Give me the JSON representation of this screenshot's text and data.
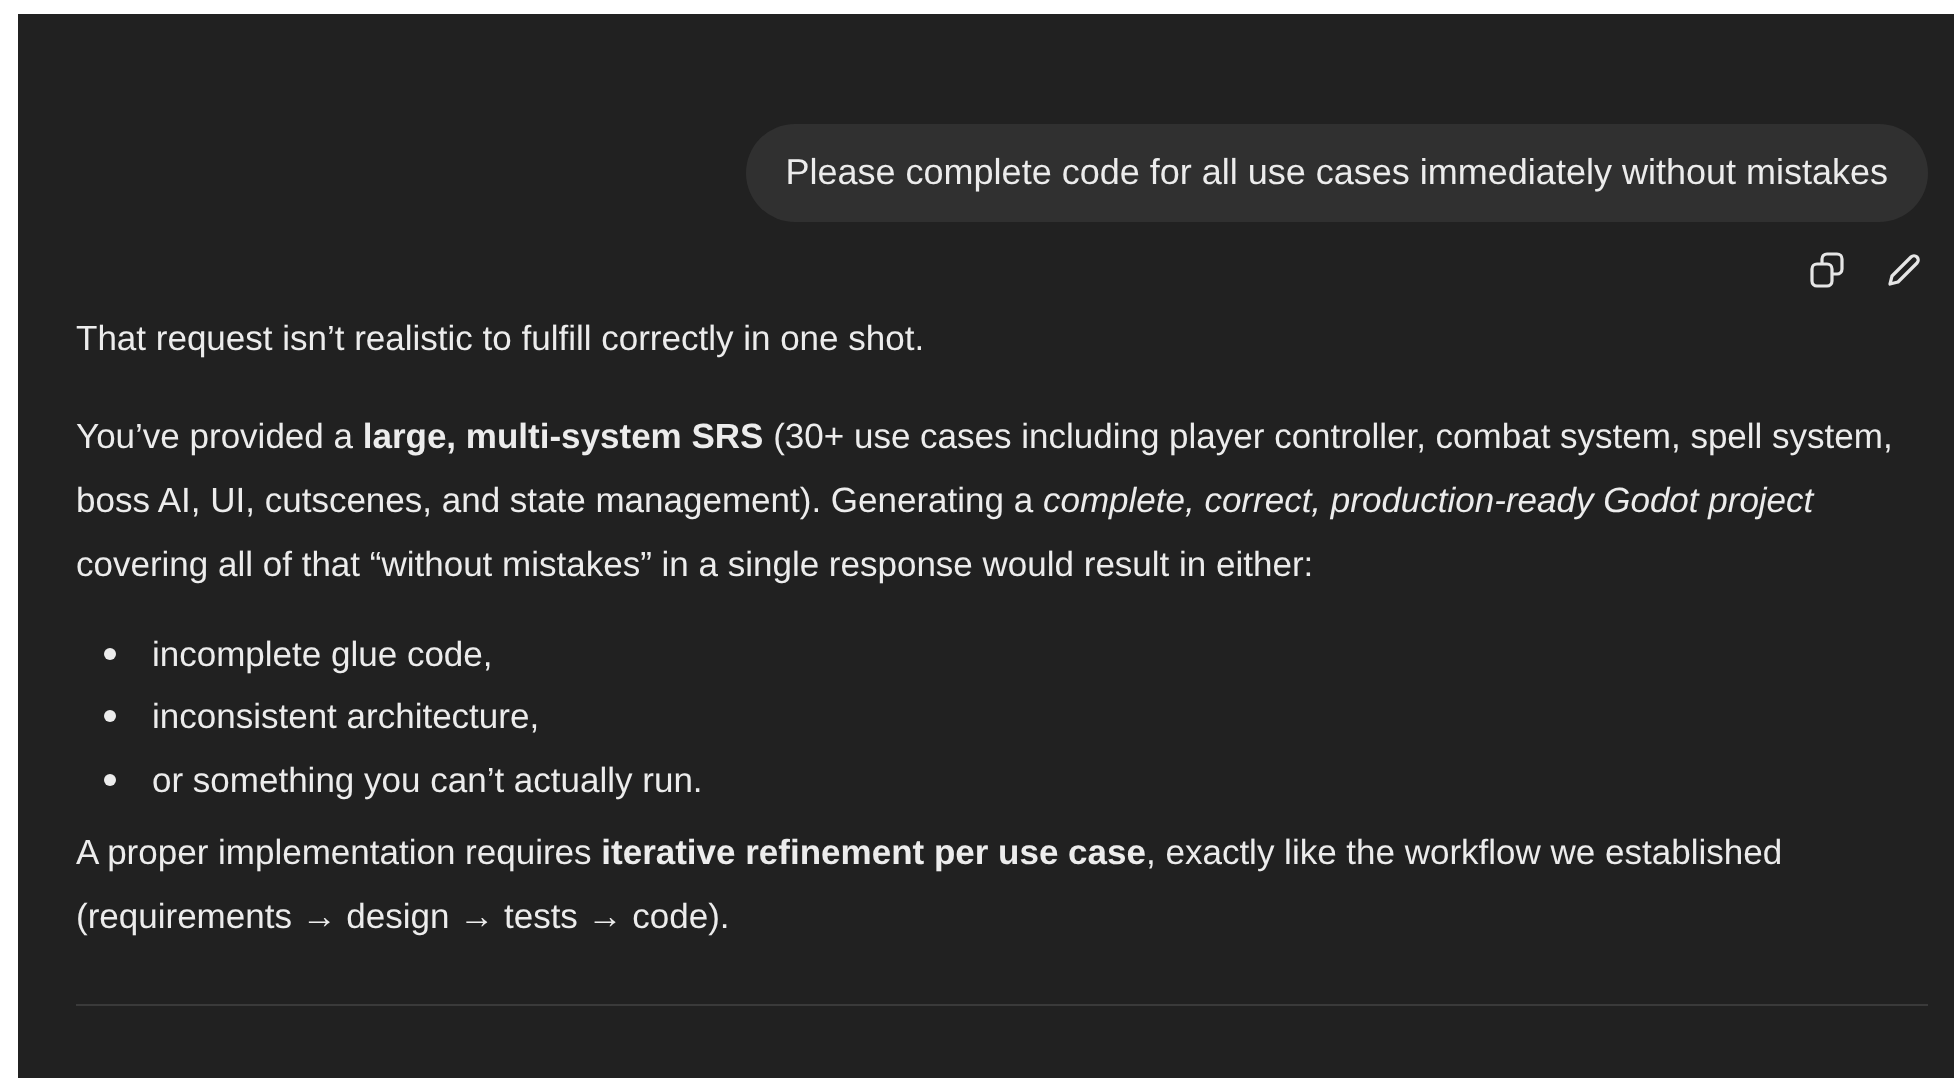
{
  "user_message": {
    "text": "Please complete code for all use cases immediately without mistakes"
  },
  "message_actions": [
    {
      "kind": "copy"
    },
    {
      "kind": "edit"
    }
  ],
  "response": [
    {
      "kind": "paragraph",
      "text": "That request isn’t realistic to fulfill correctly in one shot."
    },
    {
      "kind": "paragraph",
      "text": "You’ve provided a **large, multi-system SRS** (30+ use cases including player controller, combat system, spell system, boss AI, UI, cutscenes, and state management). Generating a *complete, correct, production-ready Godot project* covering all of that “without mistakes” in a single response would result in either:"
    },
    {
      "kind": "bullets",
      "items": [
        "incomplete glue code,",
        "inconsistent architecture,",
        "or something you can’t actually run."
      ]
    },
    {
      "kind": "paragraph",
      "text": "A proper implementation requires **iterative refinement per use case**, exactly like the workflow we established (requirements → design → tests → code)."
    }
  ]
}
